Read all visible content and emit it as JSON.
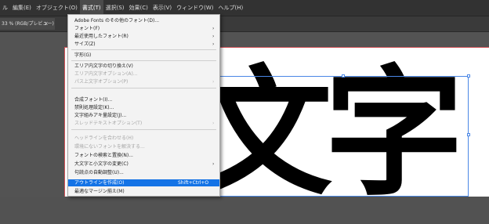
{
  "menubar": {
    "items": [
      "ル",
      "編集(E)",
      "オブジェクト(O)",
      "書式(T)",
      "選択(S)",
      "効果(C)",
      "表示(V)",
      "ウィンドウ(W)",
      "ヘルプ(H)"
    ]
  },
  "document_tab": {
    "label": "33 % (RGB/プレビュー)",
    "close": "×"
  },
  "canvas": {
    "text": "文字"
  },
  "type_menu": {
    "items": [
      {
        "label": "Adobe Fonts のその他のフォント(D)...",
        "state": "enabled"
      },
      {
        "label": "フォント(F)",
        "state": "enabled",
        "submenu": true
      },
      {
        "label": "最近使用したフォント(R)",
        "state": "enabled",
        "submenu": true
      },
      {
        "label": "サイズ(Z)",
        "state": "enabled",
        "submenu": true
      },
      {
        "label": "字形(G)",
        "state": "enabled"
      },
      {
        "label": "エリア内文字の切り換え(V)",
        "state": "enabled"
      },
      {
        "label": "エリア内文字オプション(A)...",
        "state": "disabled"
      },
      {
        "label": "パス上文字オプション(P)",
        "state": "disabled",
        "submenu": true
      },
      {
        "label": "合成フォント(I)...",
        "state": "enabled"
      },
      {
        "label": "禁則処理設定(K)...",
        "state": "enabled"
      },
      {
        "label": "文字組みアキ量設定(J)...",
        "state": "enabled"
      },
      {
        "label": "スレッドテキストオプション(T)",
        "state": "disabled",
        "submenu": true
      },
      {
        "label": "ヘッドラインを合わせる(H)",
        "state": "disabled"
      },
      {
        "label": "環境にないフォントを解決する...",
        "state": "disabled"
      },
      {
        "label": "フォントの検索と置換(N)...",
        "state": "enabled"
      },
      {
        "label": "大文字と小文字の変更(C)",
        "state": "enabled",
        "submenu": true
      },
      {
        "label": "句読点の自動調整(U)...",
        "state": "enabled"
      },
      {
        "label": "アウトラインを作成(O)",
        "state": "highlighted",
        "shortcut": "Shift+Ctrl+O"
      },
      {
        "label": "最適なマージン揃え(M)",
        "state": "enabled"
      }
    ]
  }
}
